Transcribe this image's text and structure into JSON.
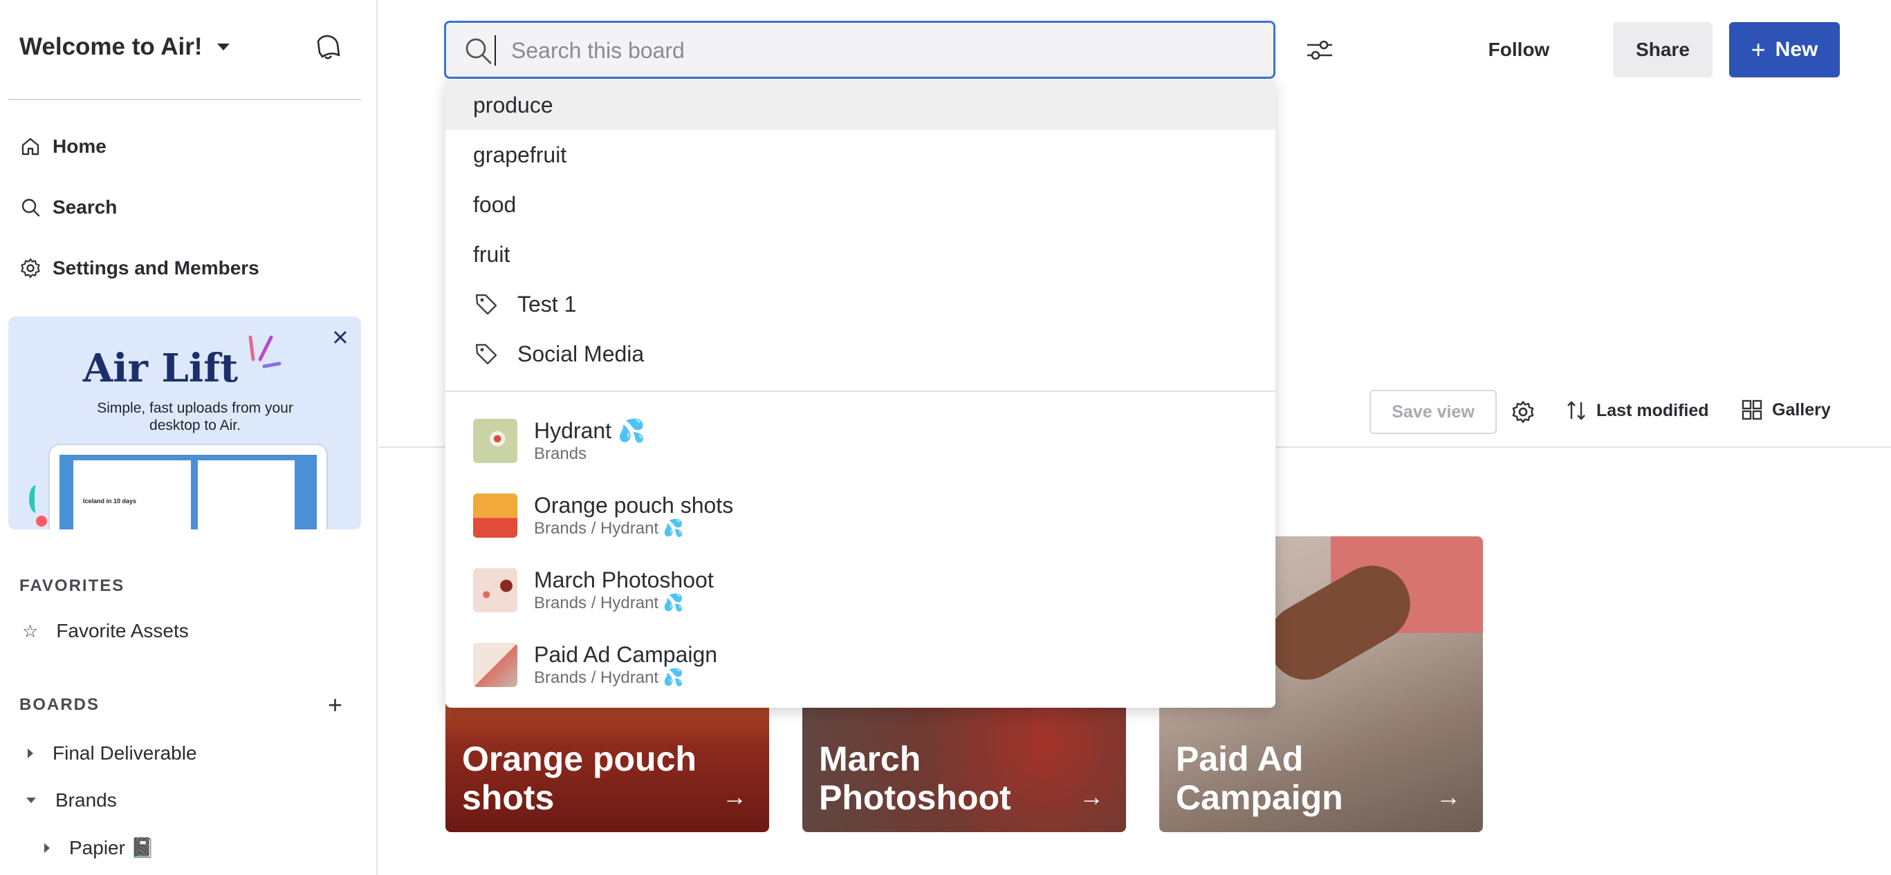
{
  "sidebar": {
    "workspace_name": "Welcome to Air!",
    "nav": [
      {
        "label": "Home",
        "icon": "home-icon"
      },
      {
        "label": "Search",
        "icon": "search-icon"
      },
      {
        "label": "Settings and Members",
        "icon": "gear-icon"
      }
    ],
    "promo": {
      "title": "Air Lift",
      "subtitle": "Simple, fast uploads from your desktop to Air.",
      "screen_caption": "Iceland in 10 days"
    },
    "favorites_label": "FAVORITES",
    "favorites": [
      {
        "label": "Favorite Assets",
        "icon": "star-icon"
      }
    ],
    "boards_label": "BOARDS",
    "boards": [
      {
        "label": "Final Deliverable",
        "expanded": false,
        "level": 0
      },
      {
        "label": "Brands",
        "expanded": true,
        "level": 0
      },
      {
        "label": "Papier 📓",
        "expanded": false,
        "level": 1
      }
    ]
  },
  "header": {
    "search": {
      "placeholder": "Search this board",
      "value": ""
    },
    "follow_label": "Follow",
    "share_label": "Share",
    "new_label": "New"
  },
  "search_dropdown": {
    "suggestions": [
      {
        "label": "produce",
        "type": "term",
        "active": true
      },
      {
        "label": "grapefruit",
        "type": "term"
      },
      {
        "label": "food",
        "type": "term"
      },
      {
        "label": "fruit",
        "type": "term"
      },
      {
        "label": "Test 1",
        "type": "tag"
      },
      {
        "label": "Social Media",
        "type": "tag"
      }
    ],
    "boards": [
      {
        "title": "Hydrant 💦",
        "path": "Brands"
      },
      {
        "title": "Orange pouch shots",
        "path": "Brands / Hydrant 💦"
      },
      {
        "title": "March Photoshoot",
        "path": "Brands / Hydrant 💦"
      },
      {
        "title": "Paid Ad Campaign",
        "path": "Brands / Hydrant 💦"
      }
    ]
  },
  "toolbar": {
    "save_view_label": "Save view",
    "sort_label": "Last modified",
    "view_label": "Gallery"
  },
  "cards": [
    {
      "title": "Orange pouch shots"
    },
    {
      "title": "March Photoshoot"
    },
    {
      "title": "Paid Ad Campaign"
    }
  ],
  "colors": {
    "accent": "#2c53b5",
    "focus": "#3a72d8",
    "promo_bg": "#dde9fb"
  }
}
